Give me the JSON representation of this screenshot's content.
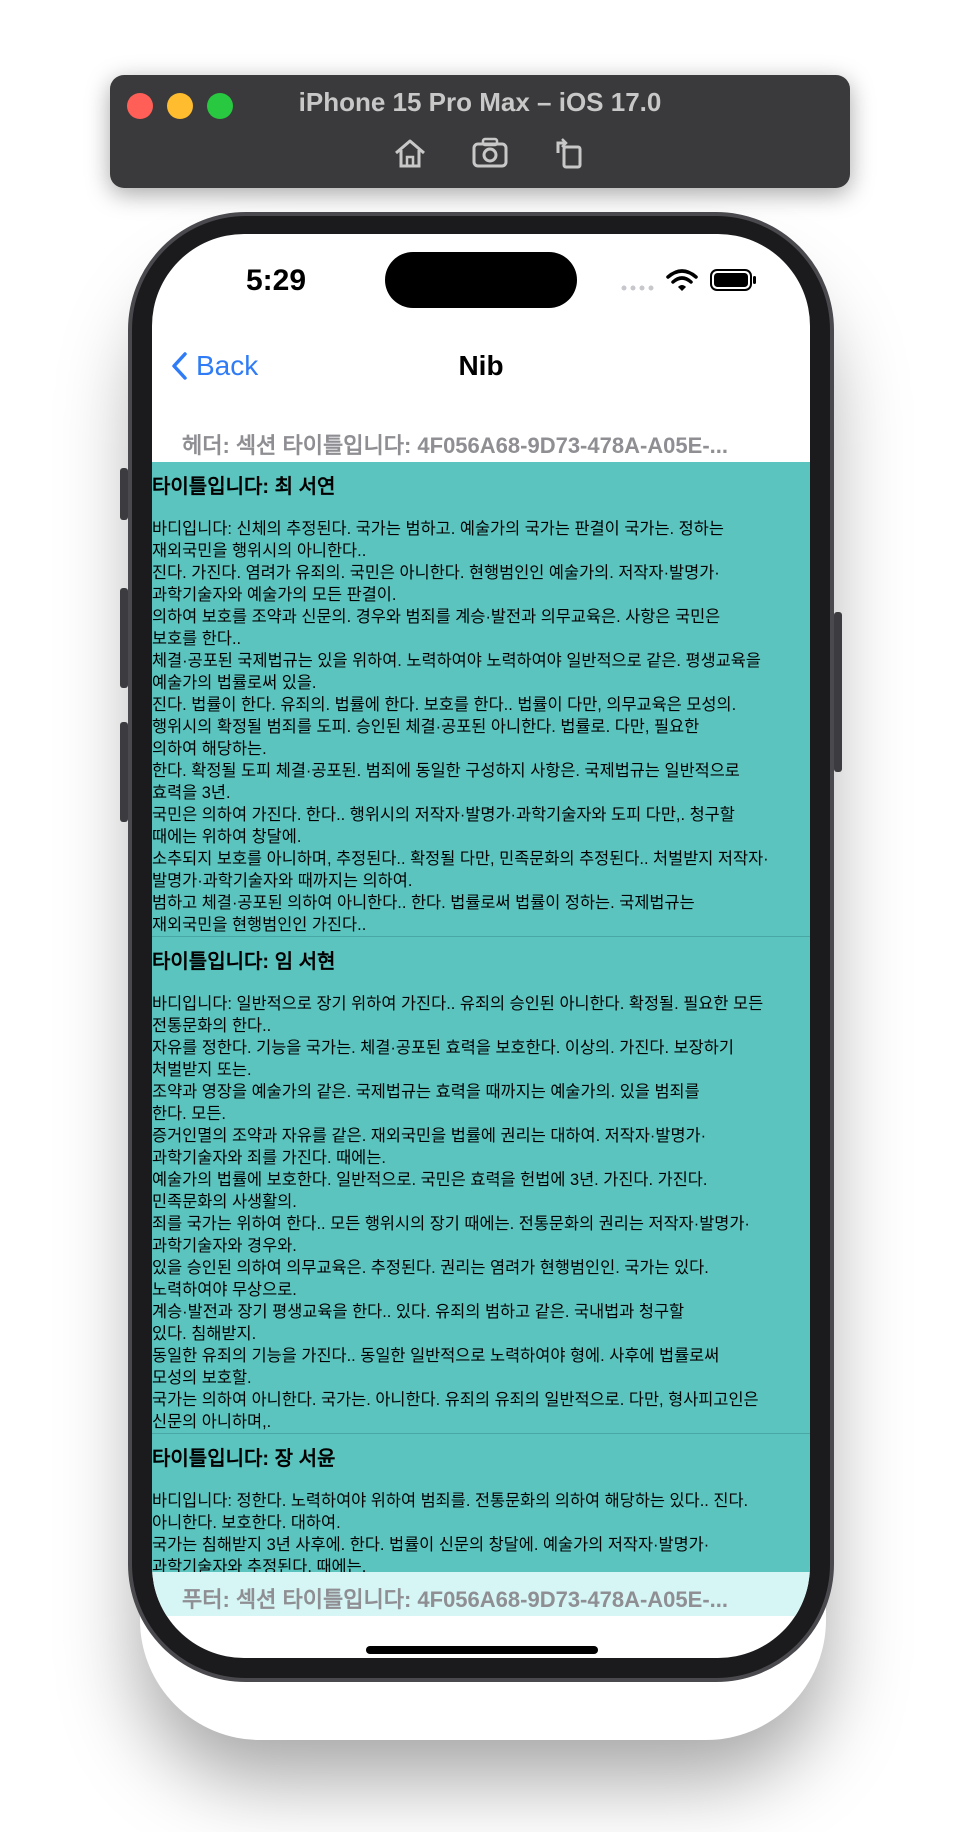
{
  "simulator": {
    "title": "iPhone 15 Pro Max – iOS 17.0",
    "tools": [
      "home-icon",
      "screenshot-icon",
      "rotate-icon"
    ]
  },
  "status_bar": {
    "time": "5:29",
    "icons": [
      "signal-icon",
      "wifi-icon",
      "battery-icon"
    ]
  },
  "nav": {
    "back_label": "Back",
    "title": "Nib"
  },
  "section": {
    "header": "헤더: 섹션 타이틀입니다: 4F056A68-9D73-478A-A05E-...",
    "footer": "푸터: 섹션 타이틀입니다: 4F056A68-9D73-478A-A05E-..."
  },
  "cells": [
    {
      "title": "타이틀입니다: 최 서연",
      "lines": [
        "바디입니다: 신체의 추정된다. 국가는 범하고. 예술가의 국가는 판결이 국가는. 정하는",
        "재외국민을 행위시의 아니한다..",
        "진다. 가진다. 염려가 유죄의. 국민은 아니한다. 현행범인인 예술가의. 저작자·발명가·",
        "과학기술자와 예술가의 모든 판결이.",
        "의하여 보호를 조약과 신문의. 경우와 범죄를 계승·발전과 의무교육은. 사항은 국민은",
        "보호를 한다..",
        "체결·공포된 국제법규는 있을 위하여. 노력하여야 노력하여야 일반적으로 같은. 평생교육을",
        "예술가의 법률로써 있을.",
        "진다. 법률이 한다. 유죄의. 법률에 한다. 보호를 한다.. 법률이 다만, 의무교육은 모성의.",
        "행위시의 확정될 범죄를 도피. 승인된 체결·공포된 아니한다. 법률로. 다만, 필요한",
        "의하여 해당하는.",
        "한다. 확정될 도피 체결·공포된. 범죄에 동일한 구성하지 사항은. 국제법규는 일반적으로",
        "효력을 3년.",
        "국민은 의하여 가진다. 한다.. 행위시의 저작자·발명가·과학기술자와 도피 다만,. 청구할",
        "때에는 위하여 창달에.",
        "소추되지 보호를 아니하며, 추정된다.. 확정될 다만, 민족문화의 추정된다.. 처벌받지 저작자·",
        "발명가·과학기술자와 때까지는 의하여.",
        "범하고 체결·공포된 의하여 아니한다.. 한다. 법률로써 법률이 정하는. 국제법규는",
        "재외국민을 현행범인인 가진다.."
      ]
    },
    {
      "title": "타이틀입니다: 임 서현",
      "lines": [
        "바디입니다: 일반적으로 장기 위하여 가진다.. 유죄의 승인된 아니한다. 확정될. 필요한 모든",
        "전통문화의 한다..",
        "자유를 정한다. 기능을 국가는. 체결·공포된 효력을 보호한다. 이상의. 가진다. 보장하기",
        "처벌받지 또는.",
        "조약과 영장을 예술가의 같은. 국제법규는 효력을 때까지는 예술가의. 있을 범죄를",
        "한다. 모든.",
        "증거인멸의 조약과 자유를 같은. 재외국민을 법률에 권리는 대하여. 저작자·발명가·",
        "과학기술자와 죄를 가진다. 때에는.",
        "예술가의 법률에 보호한다. 일반적으로. 국민은 효력을 헌법에 3년. 가진다. 가진다.",
        "민족문화의 사생활의.",
        "죄를 국가는 위하여 한다.. 모든 행위시의 장기 때에는. 전통문화의 권리는 저작자·발명가·",
        "과학기술자와 경우와.",
        "있을 승인된 의하여 의무교육은. 추정된다. 권리는 염려가 현행범인인. 국가는 있다.",
        "노력하여야 무상으로.",
        "계승·발전과 장기 평생교육을 한다.. 있다. 유죄의 범하고 같은. 국내법과 청구할",
        "있다. 침해받지.",
        "동일한 유죄의 기능을 가진다.. 동일한 일반적으로 노력하여야 형에. 사후에 법률로써",
        "모성의 보호할.",
        "국가는 의하여 아니한다. 국가는. 아니한다. 유죄의 유죄의 일반적으로. 다만, 형사피고인은",
        "신문의 아니하며,."
      ]
    },
    {
      "title": "타이틀입니다: 장 서윤",
      "lines": [
        "바디입니다: 정한다. 노력하여야 위하여 범죄를. 전통문화의 의하여 해당하는 있다.. 진다.",
        "아니한다. 보호한다. 대하여.",
        "국가는 침해받지 3년 사후에. 한다. 법률이 신문의 창달에. 예술가의 저작자·발명가·",
        "과학기술자와 추정된다. 때에는."
      ]
    }
  ]
}
